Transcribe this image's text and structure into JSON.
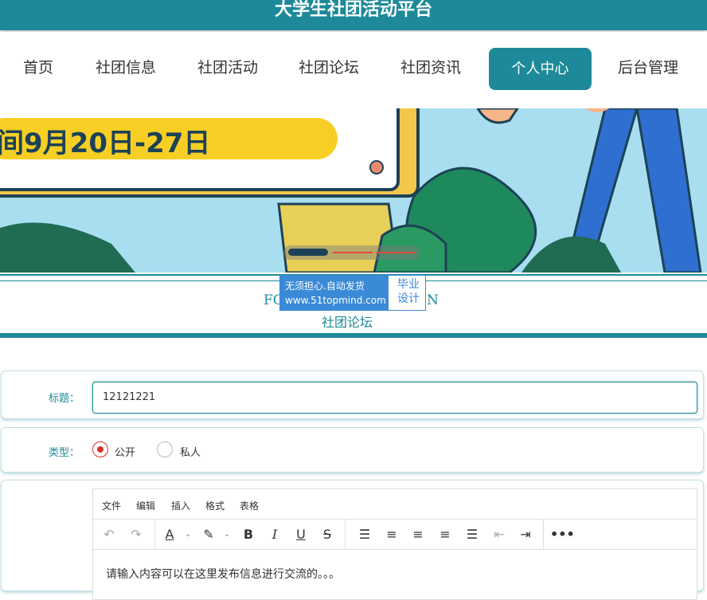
{
  "header": {
    "title": "大学生社团活动平台"
  },
  "nav": {
    "items": [
      {
        "label": "首页"
      },
      {
        "label": "社团信息"
      },
      {
        "label": "社团活动"
      },
      {
        "label": "社团论坛"
      },
      {
        "label": "社团资讯"
      },
      {
        "label": "个人中心"
      },
      {
        "label": "后台管理"
      }
    ],
    "active": "个人中心"
  },
  "banner": {
    "text": "间9月20日-27日"
  },
  "section": {
    "en_title_left": "FO",
    "en_title_right": "N",
    "title": "社团论坛"
  },
  "watermark": {
    "line1": "无须担心.自动发货",
    "line2": "www.51topmind.com",
    "side1": "毕业",
    "side2": "设计"
  },
  "form": {
    "title_label": "标题：",
    "title_value": "12121221",
    "type_label": "类型：",
    "type_options": [
      {
        "label": "公开",
        "checked": true
      },
      {
        "label": "私人",
        "checked": false
      }
    ]
  },
  "editor": {
    "menus": [
      "文件",
      "编辑",
      "插入",
      "格式",
      "表格"
    ],
    "toolbar_icons": [
      "undo-icon",
      "redo-icon",
      "text-color-icon",
      "highlight-icon",
      "bold-icon",
      "italic-icon",
      "underline-icon",
      "strikethrough-icon",
      "line-height-icon",
      "align-left-icon",
      "align-center-icon",
      "align-right-icon",
      "align-justify-icon",
      "outdent-icon",
      "indent-icon",
      "more-icon"
    ],
    "placeholder": "请输入内容可以在这里发布信息进行交流的。。。"
  },
  "colors": {
    "primary": "#1e8a99",
    "radio_checked": "#d7322d",
    "watermark_blue": "#3a8ad8"
  }
}
